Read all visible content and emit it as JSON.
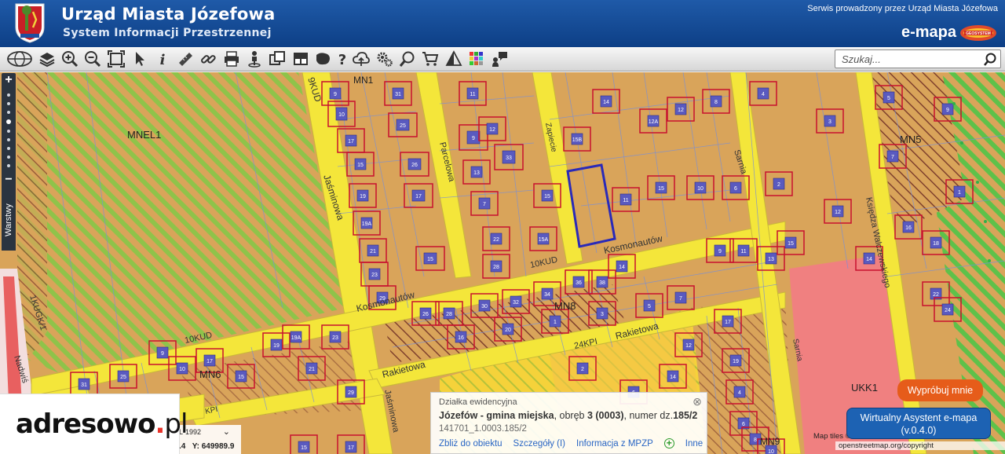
{
  "header": {
    "title": "Urząd Miasta Józefowa",
    "subtitle": "System Informacji Przestrzennej",
    "service_text": "Serwis prowadzony przez Urząd Miasta Józefowa",
    "brand": "e-mapa",
    "brand_logo_text": "GEOSYSTEM"
  },
  "toolbar": {
    "icons": [
      "globe-icon",
      "layers-icon",
      "zoom-in-icon",
      "zoom-out-icon",
      "full-extent-icon",
      "pointer-icon",
      "info-icon",
      "measure-icon",
      "link-icon",
      "print-icon",
      "street-view-icon",
      "copy-icon",
      "layout-icon",
      "map-icon",
      "help-icon",
      "cloud-upload-icon",
      "settings-icon",
      "search-zoom-icon",
      "cart-icon",
      "triangle-icon",
      "grid-color-icon",
      "comment-person-icon"
    ],
    "search_placeholder": "Szukaj..."
  },
  "sidebar": {
    "zoom_in": "+",
    "zoom_out": "−",
    "layers_label": "Warstwy"
  },
  "map_labels": {
    "zones": [
      "MN1",
      "MNEL1",
      "MN5",
      "MN8",
      "MN6",
      "UKK1",
      "MN9"
    ],
    "streets": [
      "9KUD",
      "Jaśminowa",
      "Parcelowa",
      "Zapiecie",
      "Sarnia",
      "Księdza Walczewskiego",
      "Kosmonautów",
      "10KUD",
      "Kosmonautów",
      "10KUD",
      "24KPI",
      "Rakietowa",
      "Rakietowa",
      "1KUGK/1",
      "Nadwiś",
      "Sarnia",
      "Jaśminowa",
      "KPI"
    ],
    "parcels": [
      "9",
      "10",
      "17",
      "15",
      "19",
      "19A",
      "21",
      "23",
      "29",
      "31",
      "25",
      "26",
      "17",
      "15",
      "11",
      "9",
      "13",
      "7",
      "22",
      "28",
      "12",
      "33",
      "15",
      "15A",
      "15B",
      "14",
      "11",
      "12A",
      "15",
      "12",
      "10",
      "8",
      "6",
      "4",
      "2",
      "3",
      "5",
      "7",
      "9",
      "1",
      "12",
      "14",
      "16",
      "18",
      "22",
      "24",
      "26",
      "28",
      "30",
      "32",
      "34",
      "36",
      "38",
      "14",
      "16",
      "20",
      "1",
      "3",
      "5",
      "7",
      "9",
      "11",
      "13",
      "15",
      "17",
      "19",
      "4",
      "6",
      "8",
      "10",
      "12",
      "14",
      "6",
      "2"
    ]
  },
  "popup": {
    "heading": "Działka ewidencyjna",
    "place": "Józefów - gmina miejska",
    "obreb_prefix": ", obręb ",
    "obreb": "3 (0003)",
    "numer_prefix": ", numer dz.",
    "numer": "185/2",
    "id": "141701_1.0003.185/2",
    "link_zoom": "Zbliż do obiektu",
    "link_details": "Szczegóły (I)",
    "link_mpzp": "Informacja z MPZP",
    "link_more": "Inne"
  },
  "coords": {
    "system": "L-1992",
    "x_partial": ".4",
    "y": "Y: 649989.9"
  },
  "logo": {
    "text_a": "adresowo",
    "text_b": ".",
    "text_c": "pl"
  },
  "assistant": {
    "try": "Wypróbuj mnie",
    "title": "Wirtualny Asystent e-mapa",
    "version": "(v.0.4.0)"
  },
  "attribution": {
    "line1": "Map tiles ©",
    "line2": "openstreetmap.org/copyright"
  },
  "colors": {
    "header": "#1f5aa8",
    "residential": "#d9a45a",
    "road": "#f4e63a",
    "service": "#f08080",
    "parcel_line": "#c8102e",
    "grid": "#7a8fd6",
    "selection": "#2a2ab8",
    "green_hatch": "#8fc34a"
  }
}
